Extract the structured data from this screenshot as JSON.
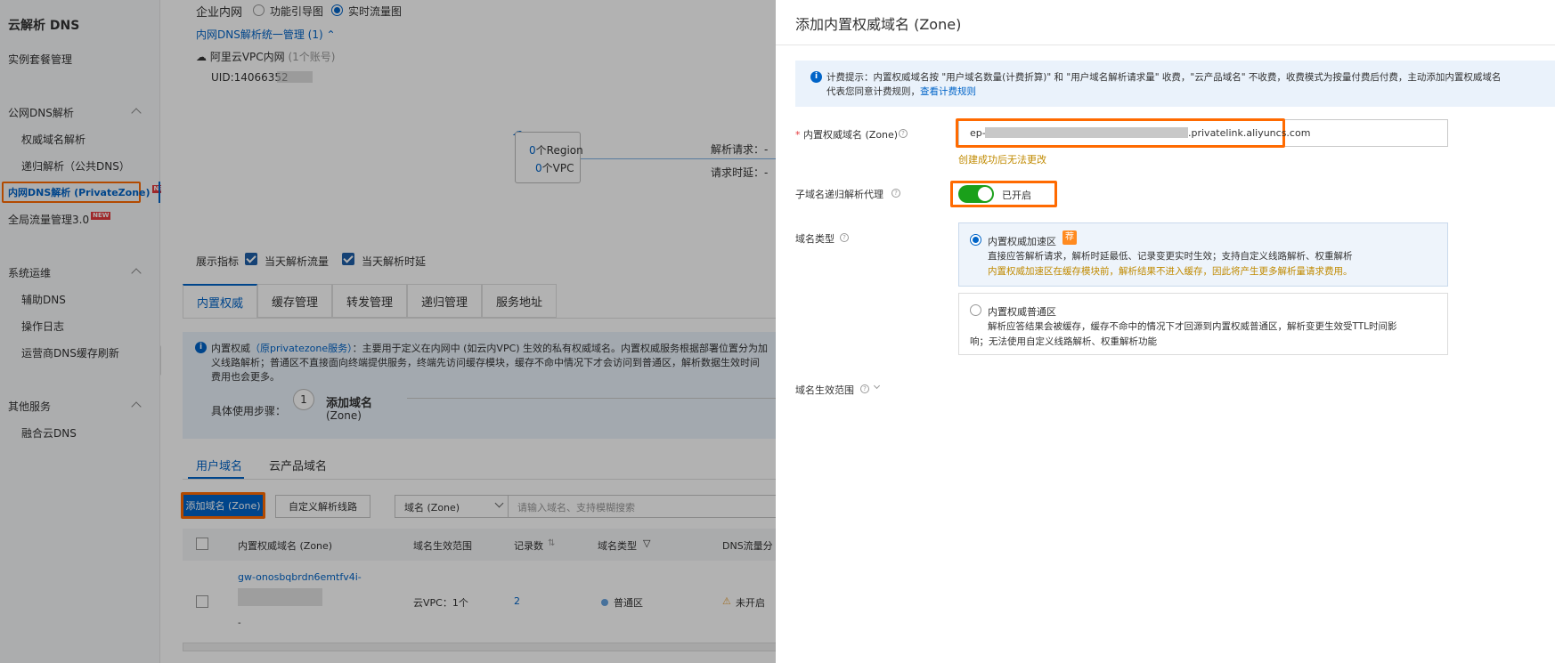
{
  "sidebar": {
    "title": "云解析 DNS",
    "instance_mgmt": "实例套餐管理",
    "group_public": "公网DNS解析",
    "auth_domain": "权威域名解析",
    "recursive": "递归解析（公共DNS）",
    "private_zone": "内网DNS解析 (PrivateZone)",
    "new_badge": "NEW",
    "gtm": "全局流量管理3.0",
    "group_ops": "系统运维",
    "aux_dns": "辅助DNS",
    "op_log": "操作日志",
    "isp_refresh": "运营商DNS缓存刷新",
    "group_other": "其他服务",
    "cloud_dns": "融合云DNS"
  },
  "main": {
    "enterprise_intranet": "企业内网",
    "radio_guide": "功能引导图",
    "radio_flow": "实时流量图",
    "unified_mgmt": "内网DNS解析统一管理 (1)",
    "vpc_title": "阿里云VPC内网",
    "vpc_count": "(1个账号)",
    "uid_label": "UID:14066352",
    "region_count": "0",
    "region_label": "个Region",
    "vpc_num": "0",
    "vpc_label": "个VPC",
    "parse_req": "解析请求：",
    "parse_req_val": "-",
    "req_timeout": "请求时延：",
    "req_timeout_val": "-",
    "show_metrics": "展示指标",
    "metric1": "当天解析流量",
    "metric2": "当天解析时延",
    "tabs": [
      "内置权威",
      "缓存管理",
      "转发管理",
      "递归管理",
      "服务地址"
    ],
    "notice_line1_a": "内置权威",
    "notice_line1_link": "（原privatezone服务）",
    "notice_line1_b": "：主要用于定义在内网中 (如云内VPC) 生效的私有权威域名。内置权威服务根据部署位置分为加",
    "notice_line2": "义线路解析；普通区不直接面向终端提供服务，终端先访问缓存模块，缓存不命中情况下才会访问到普通区，解析数据生效时间",
    "notice_line3": "费用也会更多。",
    "steps_label": "具体使用步骤：",
    "step1_num": "1",
    "step1_title": "添加域名",
    "step1_sub": "(Zone)",
    "subtabs": [
      "用户域名",
      "云产品域名"
    ],
    "add_btn": "添加域名 (Zone)",
    "custom_line_btn": "自定义解析线路",
    "filter_select": "域名 (Zone)",
    "search_placeholder": "请输入域名、支持模糊搜索",
    "columns": [
      "内置权威域名 (Zone)",
      "域名生效范围",
      "记录数",
      "域名类型",
      "DNS流量分"
    ],
    "row": {
      "zone": "gw-onosbqbrdn6emtfv4i-",
      "scope": "云VPC：1个",
      "records": "2",
      "type": "普通区",
      "dns": "未开启",
      "dash": "-"
    }
  },
  "drawer": {
    "title": "添加内置权威域名 (Zone)",
    "billing_a": "计费提示：内置权威域名按 \"用户域名数量(计费折算)\" 和 \"用户域名解析请求量\" 收费，\"云产品域名\" 不收费，收费模式为按量付费后付费，主动添加内置权威域名",
    "billing_b": "代表您同意计费规则，",
    "billing_link": "查看计费规则",
    "zone_label": "内置权威域名 (Zone)",
    "zone_prefix": "ep-",
    "zone_suffix": ".privatelink.aliyuncs.com",
    "zone_hint": "创建成功后无法更改",
    "recursive_label": "子域名递归解析代理",
    "toggle_text": "已开启",
    "type_label": "域名类型",
    "opt1_title": "内置权威加速区",
    "opt1_badge": "荐",
    "opt1_desc": "直接应答解析请求，解析时延最低、记录变更实时生效；支持自定义线路解析、权重解析",
    "opt1_warn": "内置权威加速区在缓存模块前，解析结果不进入缓存，因此将产生更多解析量请求费用。",
    "opt2_title": "内置权威普通区",
    "opt2_desc_a": "解析应答结果会被缓存，缓存不命中的情况下才回源到内置权威普通区，解析变更生效受TTL时间影",
    "opt2_desc_b": "响；无法使用自定义线路解析、权重解析功能",
    "scope_label": "域名生效范围"
  }
}
